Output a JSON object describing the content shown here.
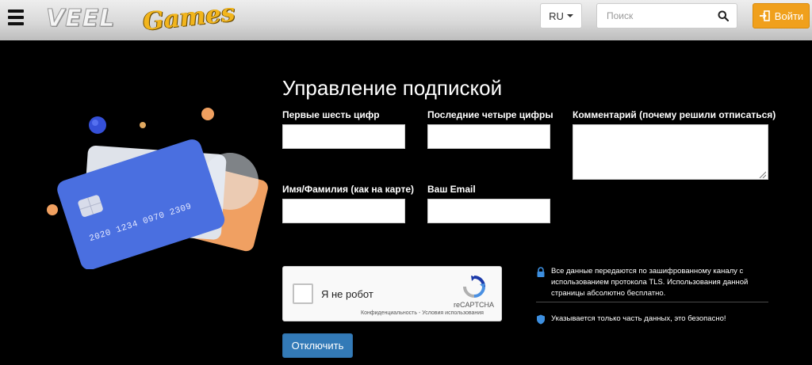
{
  "header": {
    "brand_part1": "VEEL",
    "brand_part2": "Games",
    "lang_label": "RU",
    "search_placeholder": "Поиск",
    "login_label": "Войти"
  },
  "form": {
    "title": "Управление подпиской",
    "first_digits_label": "Первые шесть цифр",
    "first_digits_value": "",
    "last_digits_label": "Последние четыре цифры",
    "last_digits_value": "",
    "comment_label": "Комментарий (почему решили отписаться)",
    "comment_value": "",
    "name_label": "Имя/Фамилия (как на карте)",
    "name_value": "",
    "email_label": "Ваш Email",
    "email_value": "",
    "submit_label": "Отключить"
  },
  "captcha": {
    "checkbox_label": "Я не робот",
    "brand": "reCAPTCHA",
    "privacy_link": "Конфиденциальность",
    "separator": "-",
    "terms_link": "Условия использования"
  },
  "info": {
    "security_text": "Все данные передаются по зашифрованному каналу с использованием протокола TLS. Использования данной страницы абсолютно бесплатно.",
    "partial_data_text": "Указывается только часть данных, это безопасно!"
  },
  "illustration": {
    "card_number": "2020 1234 0970 2309"
  },
  "colors": {
    "background": "#000000",
    "accent_orange": "#f0a01c",
    "primary_blue": "#337ab7",
    "card_blue": "#4a6fe0",
    "icon_blue": "#3d8fe0"
  }
}
